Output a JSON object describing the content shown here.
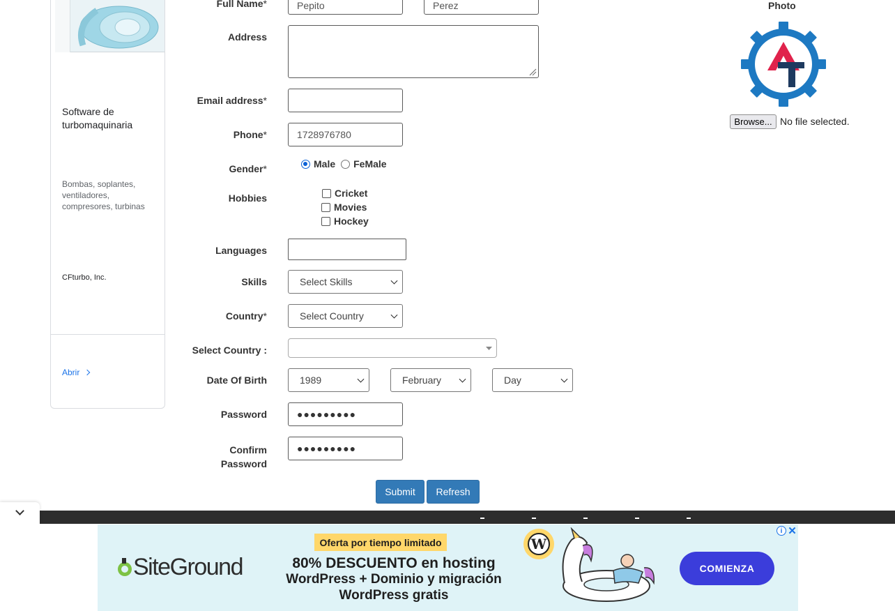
{
  "side_ad": {
    "title": "Software de turbomaquinaria",
    "description": "Bombas, soplantes, ventiladores, compresores, turbinas",
    "company": "CFturbo, Inc.",
    "open_label": "Abrir"
  },
  "form": {
    "full_name": {
      "label": "Full Name",
      "required_mark": "*",
      "first_value": "Pepito",
      "last_value": "Perez"
    },
    "address": {
      "label": "Address",
      "value": ""
    },
    "email": {
      "label": "Email address",
      "required_mark": "*",
      "value": ""
    },
    "phone": {
      "label": "Phone",
      "required_mark": "*",
      "value": "1728976780"
    },
    "gender": {
      "label": "Gender",
      "required_mark": "*",
      "options": [
        "Male",
        "FeMale"
      ],
      "selected": "Male"
    },
    "hobbies": {
      "label": "Hobbies",
      "options": [
        "Cricket",
        "Movies",
        "Hockey"
      ]
    },
    "languages": {
      "label": "Languages",
      "value": ""
    },
    "skills": {
      "label": "Skills",
      "selected": "Select Skills"
    },
    "country": {
      "label": "Country",
      "required_mark": "*",
      "selected": "Select Country"
    },
    "select_country": {
      "label": "Select Country :",
      "value": ""
    },
    "dob": {
      "label": "Date Of Birth",
      "year": "1989",
      "month": "February",
      "day": "Day"
    },
    "password": {
      "label": "Password",
      "value": "●●●●●●●●●"
    },
    "confirm_password": {
      "label_line1": "Confirm",
      "label_line2": "Password",
      "value": "●●●●●●●●●"
    },
    "submit_label": "Submit",
    "refresh_label": "Refresh"
  },
  "photo": {
    "title": "Photo",
    "browse_label": "Browse...",
    "file_status": "No file selected."
  },
  "banner": {
    "brand": "SiteGround",
    "offer": "Oferta por tiempo limitado",
    "line1": "80% DESCUENTO en hosting",
    "line2": "WordPress + Dominio y migración",
    "line3": "WordPress gratis",
    "cta": "COMIENZA"
  },
  "colors": {
    "primary_button": "#337ab7",
    "radio_accent": "#0b62d6",
    "logo_blue": "#1d79c2",
    "logo_red": "#e0224b",
    "logo_navy": "#1e3a5f",
    "banner_bg": "#dff3f7",
    "cta_bg": "#3b3ddb"
  }
}
